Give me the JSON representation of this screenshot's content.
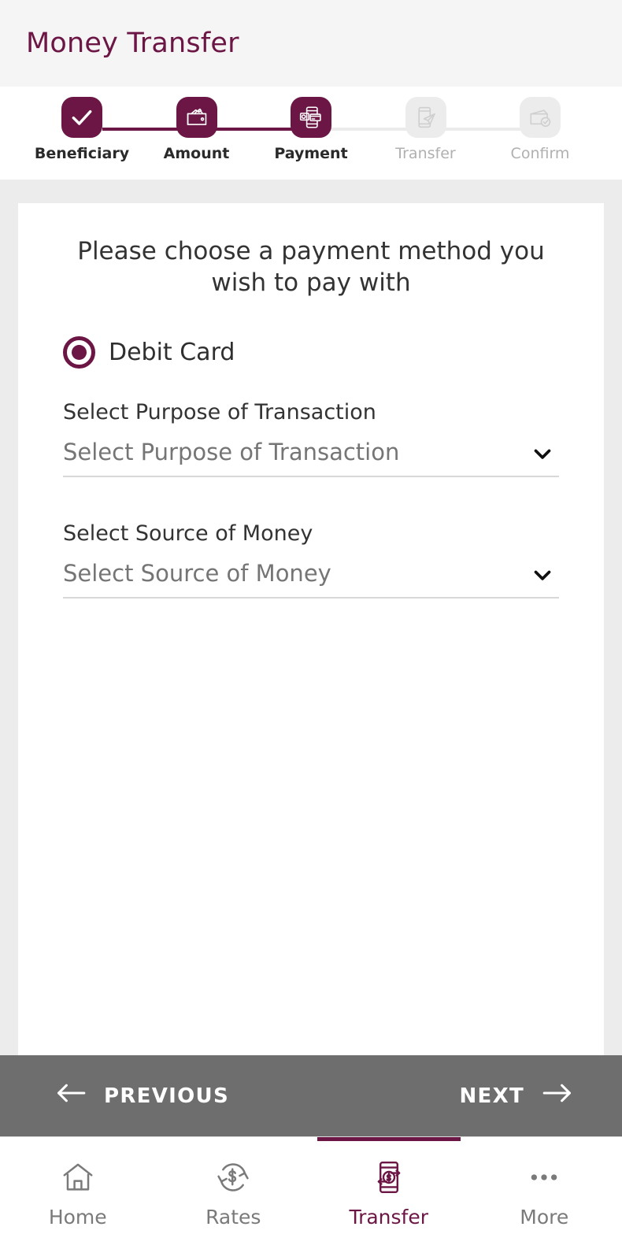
{
  "header": {
    "title": "Money Transfer"
  },
  "theme": {
    "primary": "#6b1644",
    "navbar_bg": "#6e6e6e",
    "page_bg": "#ececec",
    "muted": "#b0b0b0"
  },
  "stepper": {
    "steps": [
      {
        "label": "Beneficiary",
        "icon": "check-icon",
        "state": "completed"
      },
      {
        "label": "Amount",
        "icon": "wallet-cash-icon",
        "state": "completed"
      },
      {
        "label": "Payment",
        "icon": "phone-card-icon",
        "state": "current"
      },
      {
        "label": "Transfer",
        "icon": "phone-send-icon",
        "state": "upcoming"
      },
      {
        "label": "Confirm",
        "icon": "wallet-check-icon",
        "state": "upcoming"
      }
    ]
  },
  "main": {
    "heading": "Please choose a payment method you wish to pay with",
    "payment_methods": [
      {
        "label": "Debit Card",
        "selected": true
      }
    ],
    "fields": [
      {
        "label": "Select Purpose of Transaction",
        "placeholder": "Select Purpose of Transaction",
        "value": "",
        "icon": "chevron-down-icon"
      },
      {
        "label": "Select Source of Money",
        "placeholder": "Select Source of Money",
        "value": "",
        "icon": "chevron-down-icon"
      }
    ]
  },
  "wizard_nav": {
    "previous_label": "PREVIOUS",
    "previous_icon": "arrow-left-icon",
    "next_label": "NEXT",
    "next_icon": "arrow-right-icon"
  },
  "tabbar": {
    "tabs": [
      {
        "label": "Home",
        "icon": "home-icon",
        "active": false
      },
      {
        "label": "Rates",
        "icon": "exchange-rate-icon",
        "active": false
      },
      {
        "label": "Transfer",
        "icon": "phone-transfer-icon",
        "active": true
      },
      {
        "label": "More",
        "icon": "more-dots-icon",
        "active": false
      }
    ]
  }
}
